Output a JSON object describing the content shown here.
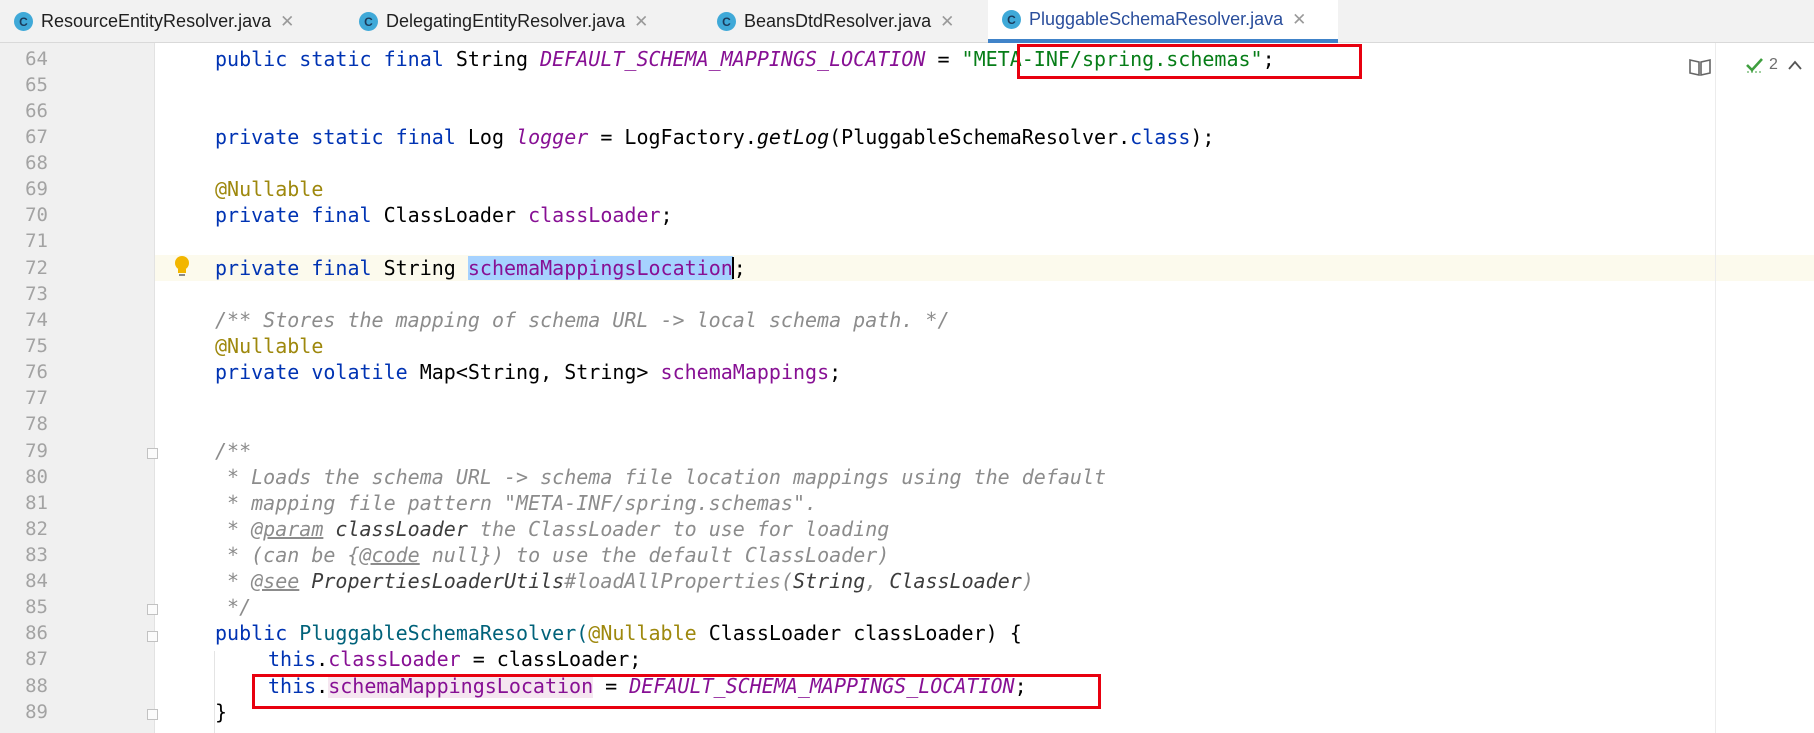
{
  "tabs": [
    {
      "label": "ResourceEntityResolver.java",
      "icon": "C",
      "active": false
    },
    {
      "label": "DelegatingEntityResolver.java",
      "icon": "C",
      "active": false
    },
    {
      "label": "BeansDtdResolver.java",
      "icon": "C",
      "active": false
    },
    {
      "label": "PluggableSchemaResolver.java",
      "icon": "C",
      "active": true
    }
  ],
  "tab_close_glyph": "✕",
  "line_numbers": [
    "64",
    "65",
    "66",
    "67",
    "68",
    "69",
    "70",
    "71",
    "72",
    "73",
    "74",
    "75",
    "76",
    "77",
    "78",
    "79",
    "80",
    "81",
    "82",
    "83",
    "84",
    "85",
    "86",
    "87",
    "88",
    "89"
  ],
  "code": {
    "l64": {
      "kw": "public static final",
      "type": " String ",
      "const": "DEFAULT_SCHEMA_MAPPINGS_LOCATION",
      "eq": " = ",
      "str": "\"META-INF/spring.schemas\"",
      "end": ";"
    },
    "l67": {
      "kw": "private static final",
      "type": " Log ",
      "field": "logger",
      "eq": " = LogFactory.",
      "method": "getLog",
      "args": "(PluggableSchemaResolver.",
      "cls": "class",
      "end": ");"
    },
    "l69": {
      "ann": "@Nullable"
    },
    "l70": {
      "kw": "private final",
      "type": " ClassLoader ",
      "field": "classLoader",
      "end": ";"
    },
    "l72": {
      "kw": "private final",
      "type": " String ",
      "field": "schemaMappingsLocation",
      "end": ";"
    },
    "l74": {
      "cmt": "/** Stores the mapping of schema URL -> local schema path. */"
    },
    "l75": {
      "ann": "@Nullable"
    },
    "l76": {
      "kw": "private volatile",
      "type": " Map<String, String> ",
      "field": "schemaMappings",
      "end": ";"
    },
    "l79": {
      "cmt": "/**"
    },
    "l80": {
      "cmt": " * Loads the schema URL -> schema file location mappings using the default"
    },
    "l81": {
      "cmt": " * mapping file pattern \"META-INF/spring.schemas\"."
    },
    "l82": {
      "pre": " * ",
      "tag": "@param",
      "ref": " classLoader",
      "rest": " the ClassLoader to use for loading"
    },
    "l83": {
      "pre": " * (can be {",
      "tag": "@code",
      "rest": " null}) to use the default ClassLoader)"
    },
    "l84": {
      "pre": " * ",
      "tag": "@see",
      "ref": " PropertiesLoaderUtils",
      "rest": "#loadAllProperties(",
      "ref2": "String",
      "rest2": ", ",
      "ref3": "ClassLoader",
      "rest3": ")"
    },
    "l85": {
      "cmt": " */"
    },
    "l86": {
      "kw": "public",
      "ctor": " PluggableSchemaResolver(",
      "ann": "@Nullable",
      "rest": " ClassLoader classLoader) {"
    },
    "l87": {
      "kw": "this",
      "dot": ".",
      "field": "classLoader",
      "rest": " = classLoader;"
    },
    "l88": {
      "kw": "this",
      "dot": ".",
      "field": "schemaMappingsLocation",
      "eq": " = ",
      "const": "DEFAULT_SCHEMA_MAPPINGS_LOCATION",
      "end": ";"
    },
    "l89": {
      "brace": "}"
    }
  },
  "inspection": {
    "count": "2",
    "status_color": "#3f9f3f"
  },
  "colors": {
    "highlight_box": "#e8000f",
    "accent_tab": "#4083c9"
  }
}
